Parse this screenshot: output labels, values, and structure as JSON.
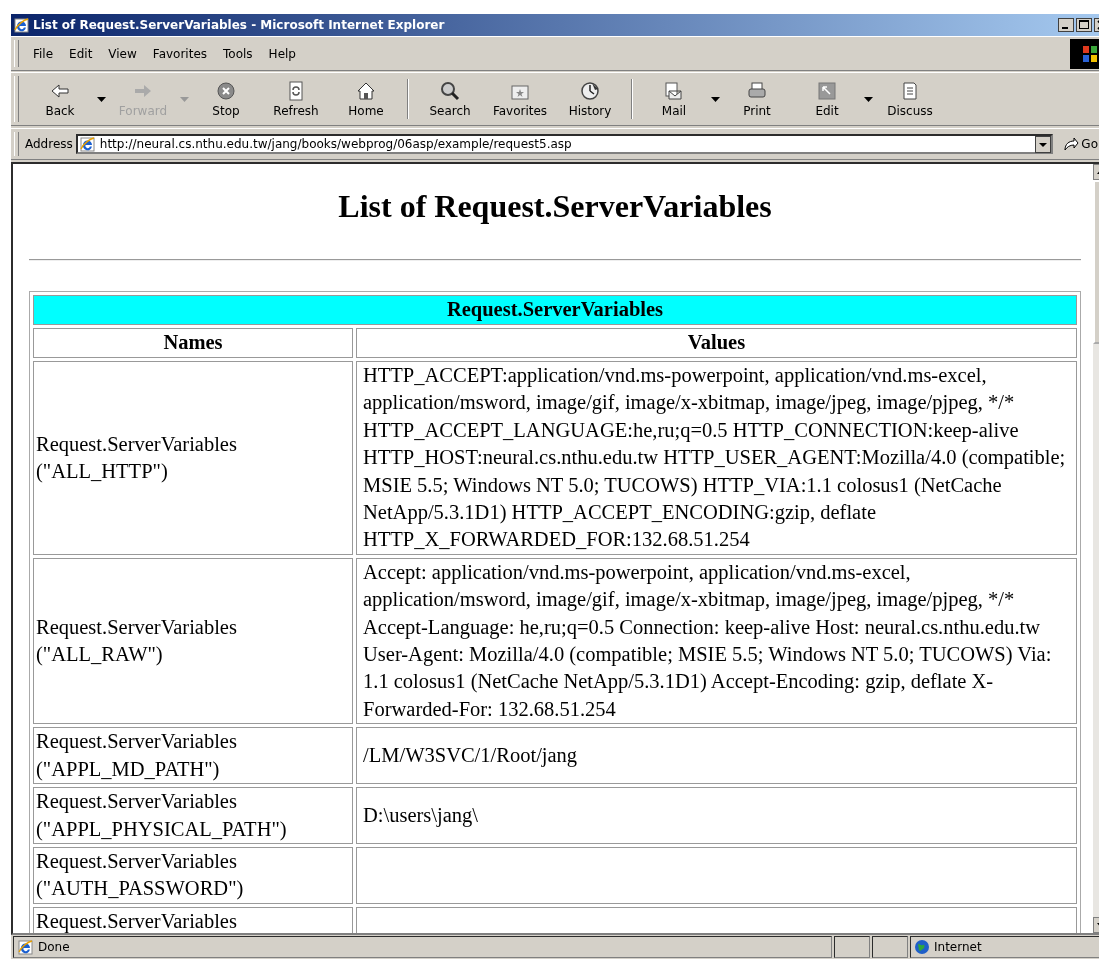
{
  "window": {
    "title": "List of Request.ServerVariables - Microsoft Internet Explorer"
  },
  "menu": [
    "File",
    "Edit",
    "View",
    "Favorites",
    "Tools",
    "Help"
  ],
  "toolbar": [
    {
      "buttons": [
        {
          "label": "Back",
          "disabled": false,
          "kind": "split"
        },
        {
          "label": "Forward",
          "disabled": true,
          "kind": "split"
        },
        {
          "label": "Stop",
          "disabled": false,
          "kind": "plain"
        },
        {
          "label": "Refresh",
          "disabled": false,
          "kind": "plain"
        },
        {
          "label": "Home",
          "disabled": false,
          "kind": "plain"
        }
      ]
    },
    {
      "buttons": [
        {
          "label": "Search",
          "disabled": false,
          "kind": "plain"
        },
        {
          "label": "Favorites",
          "disabled": false,
          "kind": "plain"
        },
        {
          "label": "History",
          "disabled": false,
          "kind": "plain"
        }
      ]
    },
    {
      "buttons": [
        {
          "label": "Mail",
          "disabled": false,
          "kind": "split"
        },
        {
          "label": "Print",
          "disabled": false,
          "kind": "plain"
        },
        {
          "label": "Edit",
          "disabled": false,
          "kind": "split"
        },
        {
          "label": "Discuss",
          "disabled": false,
          "kind": "plain"
        }
      ]
    }
  ],
  "address_bar": {
    "label": "Address",
    "url": "http://neural.cs.nthu.edu.tw/jang/books/webprog/06asp/example/request5.asp",
    "go": "Go"
  },
  "page": {
    "heading": "List of Request.ServerVariables",
    "table": {
      "caption": "Request.ServerVariables",
      "columns": [
        "Names",
        "Values"
      ],
      "rows": [
        {
          "name": [
            "Request.ServerVariables",
            "(\"ALL_HTTP\")"
          ],
          "value": "HTTP_ACCEPT:application/vnd.ms-powerpoint, application/vnd.ms-excel, application/msword, image/gif, image/x-xbitmap, image/jpeg, image/pjpeg, */* HTTP_ACCEPT_LANGUAGE:he,ru;q=0.5 HTTP_CONNECTION:keep-alive HTTP_HOST:neural.cs.nthu.edu.tw HTTP_USER_AGENT:Mozilla/4.0 (compatible; MSIE 5.5; Windows NT 5.0; TUCOWS) HTTP_VIA:1.1 colosus1 (NetCache NetApp/5.3.1D1) HTTP_ACCEPT_ENCODING:gzip, deflate HTTP_X_FORWARDED_FOR:132.68.51.254"
        },
        {
          "name": [
            "Request.ServerVariables",
            "(\"ALL_RAW\")"
          ],
          "value": "Accept: application/vnd.ms-powerpoint, application/vnd.ms-excel, application/msword, image/gif, image/x-xbitmap, image/jpeg, image/pjpeg, */* Accept-Language: he,ru;q=0.5 Connection: keep-alive Host: neural.cs.nthu.edu.tw User-Agent: Mozilla/4.0 (compatible; MSIE 5.5; Windows NT 5.0; TUCOWS) Via: 1.1 colosus1 (NetCache NetApp/5.3.1D1) Accept-Encoding: gzip, deflate X-Forwarded-For: 132.68.51.254"
        },
        {
          "name": [
            "Request.ServerVariables",
            "(\"APPL_MD_PATH\")"
          ],
          "value": "/LM/W3SVC/1/Root/jang"
        },
        {
          "name": [
            "Request.ServerVariables",
            "(\"APPL_PHYSICAL_PATH\")"
          ],
          "value": "D:\\users\\jang\\"
        },
        {
          "name": [
            "Request.ServerVariables",
            "(\"AUTH_PASSWORD\")"
          ]
        },
        {
          "name": [
            "Request.ServerVariables"
          ]
        }
      ]
    }
  },
  "status_bar": {
    "text": "Done",
    "zone": "Internet"
  }
}
